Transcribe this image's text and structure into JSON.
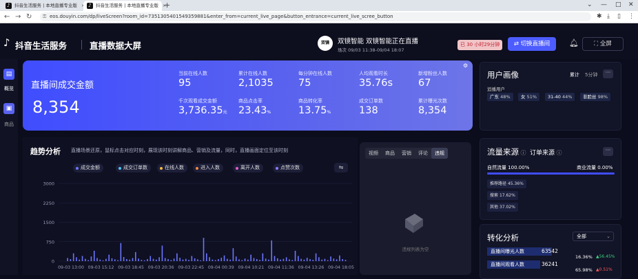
{
  "browser": {
    "tabs": [
      {
        "label": "抖音生活服务 | 本地直播专业版",
        "active": false
      },
      {
        "label": "抖音生活服务 | 本地直播专业版",
        "active": true
      }
    ],
    "url": "eos.douyin.com/dp/liveScreen?room_id=7351305401549359881&enter_from=current_live_page&button_entrance=current_live_scree_button"
  },
  "header": {
    "brand": "抖音生活服务",
    "page_title": "直播数据大屏",
    "avatar_text": "双镜",
    "room_status": "双镜智能  双镜智能正在直播",
    "session": "场次 09/03 11:38-09/04 18:07",
    "live_timer": "已 30 小时29分钟",
    "switch_label": "切换直播间",
    "fullscreen_label": "全屏"
  },
  "sidebar": {
    "items": [
      {
        "label": "概览"
      },
      {
        "label": "商品"
      }
    ]
  },
  "kpi": {
    "main_label": "直播间成交金额",
    "main_value": "8,354",
    "metrics": [
      {
        "label": "当前在线人数",
        "value": "95",
        "unit": ""
      },
      {
        "label": "累计在线人数",
        "value": "2,1035",
        "unit": ""
      },
      {
        "label": "每分钟在线人数",
        "value": "75",
        "unit": ""
      },
      {
        "label": "人均观看时长",
        "value": "35.76s",
        "unit": ""
      },
      {
        "label": "新增粉丝人数",
        "value": "67",
        "unit": ""
      },
      {
        "label": "千次观看成交金额",
        "value": "3,736.35",
        "unit": "元"
      },
      {
        "label": "商品点击率",
        "value": "23.43",
        "unit": "%"
      },
      {
        "label": "商品转化率",
        "value": "13.75",
        "unit": "%"
      },
      {
        "label": "成交订单数",
        "value": "138",
        "unit": ""
      },
      {
        "label": "累计曝光次数",
        "value": "8,354",
        "unit": ""
      }
    ]
  },
  "trend": {
    "title": "趋势分析",
    "subtitle": "直播场景还原，鼠标点击对应时刻，展现该时刻讲解商品、营销及流量，同时，直播画面定位至该时刻",
    "legend": [
      {
        "label": "成交金额",
        "color": "#6c76ff"
      },
      {
        "label": "成交订单数",
        "color": "#4fc3f7"
      },
      {
        "label": "在线人数",
        "color": "#f5b942"
      },
      {
        "label": "进入人数",
        "color": "#f58a42"
      },
      {
        "label": "离开人数",
        "color": "#e25fd0"
      },
      {
        "label": "点赞次数",
        "color": "#8f7bff"
      }
    ]
  },
  "chart_data": {
    "type": "bar",
    "yticks": [
      "3000",
      "2250",
      "1500",
      "750",
      "0"
    ],
    "ylim": [
      0,
      3000
    ],
    "xticks": [
      "09-03 13:00",
      "09-03 15:12",
      "09-03 18:45",
      "09-03 20:36",
      "09-03 22:45",
      "09-04 00:39",
      "09-04 10:21",
      "09-04 11:36",
      "09-04 13:26",
      "09-04 18:05"
    ],
    "series": [
      {
        "name": "成交金额",
        "color": "#6c76ff",
        "values": [
          0,
          120,
          80,
          300,
          150,
          60,
          200,
          90,
          40,
          180,
          400,
          120,
          60,
          30,
          90,
          250,
          110,
          70,
          40,
          700,
          160,
          80,
          60,
          120,
          350,
          100,
          50,
          30,
          80,
          200,
          90,
          60,
          150,
          600,
          120,
          80,
          40,
          100,
          300,
          130,
          60,
          90,
          50,
          200,
          110,
          70,
          30,
          900,
          300,
          150,
          60,
          40,
          80,
          130,
          220,
          90,
          60,
          500,
          180,
          70,
          40,
          100,
          60,
          250,
          120,
          80,
          50,
          300,
          100,
          60,
          800,
          200,
          110,
          60,
          90,
          150,
          70,
          40,
          400,
          200,
          90,
          60,
          130,
          80,
          50,
          300,
          150,
          60,
          90,
          40,
          180,
          100,
          70,
          220,
          80,
          50
        ]
      }
    ]
  },
  "video": {
    "tabs": [
      {
        "label": "视频",
        "active": false
      },
      {
        "label": "商品",
        "active": false
      },
      {
        "label": "营销",
        "active": false
      },
      {
        "label": "评论",
        "active": false
      },
      {
        "label": "违规",
        "active": true
      }
    ],
    "empty_text": "违规列表为空"
  },
  "portrait": {
    "title": "用户画像",
    "tab_cumulative": "累计",
    "tab_five_min": "5分钟",
    "sub": "追播用户",
    "chips": [
      {
        "label": "广东",
        "value": "48%"
      },
      {
        "label": "女",
        "value": "51%"
      },
      {
        "label": "31-40",
        "value": "44%"
      },
      {
        "label": "非脸丝",
        "value": "98%"
      }
    ]
  },
  "traffic": {
    "title": "流量来源",
    "title2": "订单来源",
    "natural": "自然流量 100.00%",
    "commercial": "商业流量 0.00%",
    "rows": [
      {
        "label": "推荐路径",
        "value": "45.36%"
      },
      {
        "label": "搜索",
        "value": "17.62%"
      },
      {
        "label": "其他",
        "value": "37.02%"
      }
    ]
  },
  "conversion": {
    "title": "转化分析",
    "select": "全部",
    "rows": [
      {
        "label": "直播间曝光人数",
        "value": "63542",
        "pct": "16.36%",
        "delta": "▲56.45%",
        "delta_color": "#3ccf7a",
        "fill": 0.85
      },
      {
        "label": "直播间观看人数",
        "value": "36241",
        "pct": "65.98%",
        "delta": "▲0.51%",
        "delta_color": "#ff5a5a",
        "fill": 0.7
      }
    ]
  }
}
